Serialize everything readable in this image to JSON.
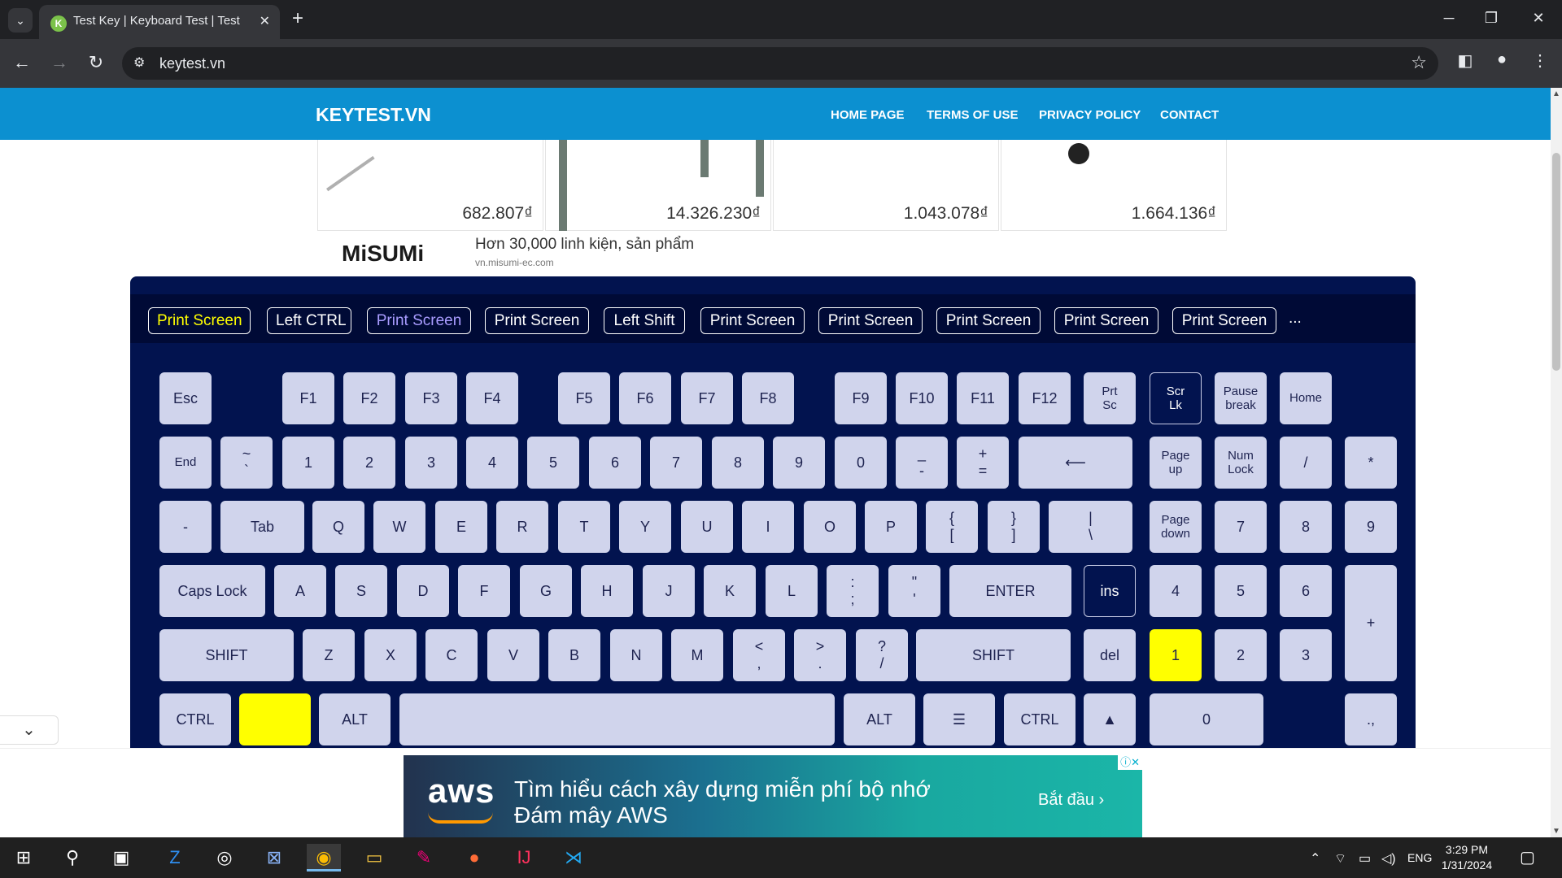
{
  "browser": {
    "tab_title": "Test Key | Keyboard Test | Test Keyboard Online",
    "tab_favicon_letter": "K",
    "url": "keytest.vn",
    "new_tab": "+",
    "tab_close": "✕"
  },
  "site": {
    "logo": "KEYTEST.VN",
    "menu": [
      "HOME PAGE",
      "TERMS OF USE",
      "PRIVACY POLICY",
      "CONTACT"
    ]
  },
  "ad_top": {
    "prices": [
      "682.807₫",
      "14.326.230₫",
      "1.043.078₫",
      "1.664.136₫"
    ],
    "brand": "MiSUMi",
    "headline": "Hơn 30,000 linh kiện, sản phẩm",
    "source": "vn.misumi-ec.com"
  },
  "history": {
    "items": [
      {
        "label": "Print Screen",
        "color": "#ffff00"
      },
      {
        "label": "Left CTRL",
        "color": "#ffffff"
      },
      {
        "label": "Print Screen",
        "color": "#a99cff"
      },
      {
        "label": "Print Screen",
        "color": "#ffffff"
      },
      {
        "label": "Left Shift",
        "color": "#ffffff"
      },
      {
        "label": "Print Screen",
        "color": "#ffffff"
      },
      {
        "label": "Print Screen",
        "color": "#ffffff"
      },
      {
        "label": "Print Screen",
        "color": "#ffffff"
      },
      {
        "label": "Print Screen",
        "color": "#ffffff"
      },
      {
        "label": "Print Screen",
        "color": "#ffffff"
      }
    ],
    "more": "..."
  },
  "keyboard": {
    "row1": [
      "Esc",
      "F1",
      "F2",
      "F3",
      "F4",
      "F5",
      "F6",
      "F7",
      "F8",
      "F9",
      "F10",
      "F11",
      "F12",
      "Prt|Sc",
      "Scr|Lk",
      "Pause|break",
      "Home"
    ],
    "row2": [
      "End",
      "~|`",
      "1",
      "2",
      "3",
      "4",
      "5",
      "6",
      "7",
      "8",
      "9",
      "0",
      "_|-",
      "+|=",
      "⟵",
      "Page|up",
      "Num|Lock",
      "/",
      "*"
    ],
    "row3": [
      "-",
      "Tab",
      "Q",
      "W",
      "E",
      "R",
      "T",
      "Y",
      "U",
      "I",
      "O",
      "P",
      "{|[",
      "}|]",
      "||\\",
      "Page|down",
      "7",
      "8",
      "9"
    ],
    "row4": [
      "Caps Lock",
      "A",
      "S",
      "D",
      "F",
      "G",
      "H",
      "J",
      "K",
      "L",
      ":|;",
      "\"|'",
      "ENTER",
      "ins",
      "4",
      "5",
      "6",
      "+"
    ],
    "row5": [
      "SHIFT",
      "Z",
      "X",
      "C",
      "V",
      "B",
      "N",
      "M",
      "<|,",
      ">|.",
      "?|/",
      "SHIFT",
      "del",
      "1",
      "2",
      "3"
    ],
    "row6": [
      "CTRL",
      "",
      "ALT",
      "",
      "ALT",
      "☰",
      "CTRL",
      "▲",
      "0",
      ".,"
    ],
    "highlight_color": "#ffff00",
    "highlighted": [
      "Scr Lk (dark)",
      "ins (dark)",
      "Numpad 1",
      "Left Win"
    ]
  },
  "bottom_ad": {
    "logo": "aws",
    "message": "Tìm hiểu cách xây dựng miễn phí bộ nhớ Đám mây AWS",
    "cta": "Bắt đầu ›",
    "adchoices": "ⓘ✕"
  },
  "taskbar": {
    "apps": [
      "start-icon",
      "search-icon",
      "task-view-icon",
      "zalo-icon",
      "obs-icon",
      "ssms-icon",
      "chrome-icon",
      "file-explorer-icon",
      "paint-icon",
      "postman-icon",
      "intellij-icon",
      "vscode-icon"
    ],
    "language": "ENG",
    "time": "3:29 PM",
    "date": "1/31/2024"
  }
}
